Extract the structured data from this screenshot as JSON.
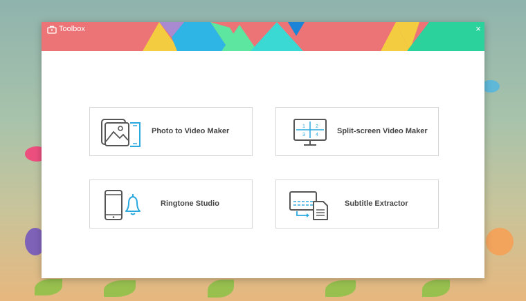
{
  "window": {
    "title": "Toolbox",
    "close_glyph": "×",
    "title_icon": "toolbox-icon",
    "banner_colors": [
      "#ec7476",
      "#f4cc3f",
      "#a98ad1",
      "#2fb5e5",
      "#5ce6a0",
      "#3ad9d4",
      "#1b84d6",
      "#2bd29b"
    ]
  },
  "tools": [
    {
      "label": "Photo to Video Maker",
      "icon": "photo-to-video-icon"
    },
    {
      "label": "Split-screen Video Maker",
      "icon": "split-screen-icon",
      "grid_numbers": [
        "1",
        "2",
        "3",
        "4"
      ]
    },
    {
      "label": "Ringtone Studio",
      "icon": "ringtone-icon"
    },
    {
      "label": "Subtitle Extractor",
      "icon": "subtitle-extractor-icon"
    }
  ],
  "colors": {
    "accent": "#2aa9e0",
    "icon_stroke": "#555555",
    "text": "#444444"
  }
}
